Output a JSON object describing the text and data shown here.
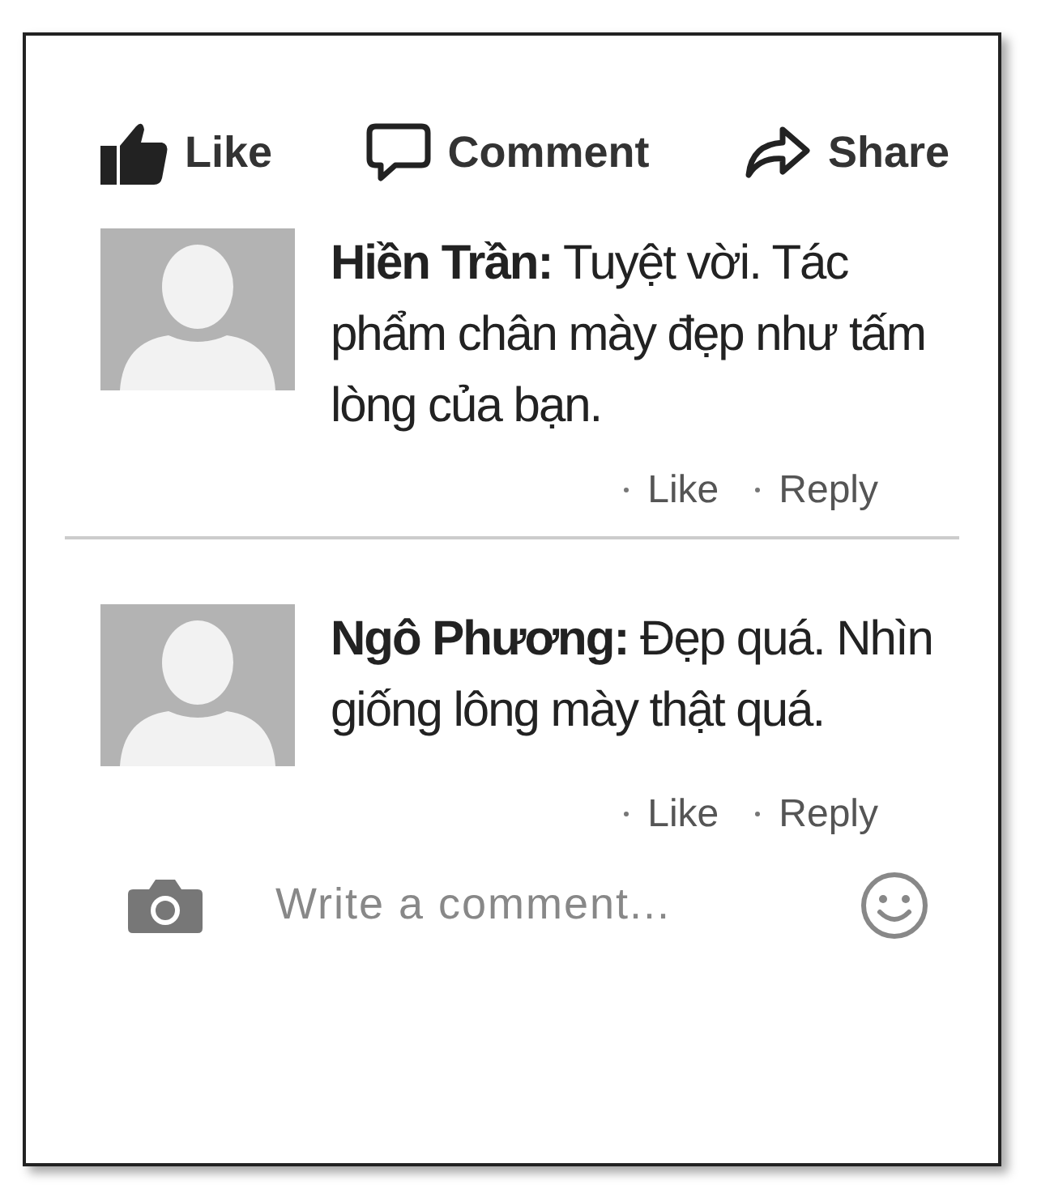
{
  "actions": [
    {
      "kind": "like",
      "label": "Like"
    },
    {
      "kind": "comment",
      "label": "Comment"
    },
    {
      "kind": "share",
      "label": "Share"
    }
  ],
  "comments": [
    {
      "text": "**Hiền Trần:** Tuyệt vời. Tác phẩm chân mày đẹp như tấm lòng của bạn.",
      "links": [
        "Like",
        "Reply"
      ]
    },
    {
      "text": "**Ngô Phương:** Đẹp quá. Nhìn giống lông mày thật quá.",
      "links": [
        "Like",
        "Reply"
      ]
    }
  ],
  "composer": {
    "placeholder": "Write a comment..."
  }
}
